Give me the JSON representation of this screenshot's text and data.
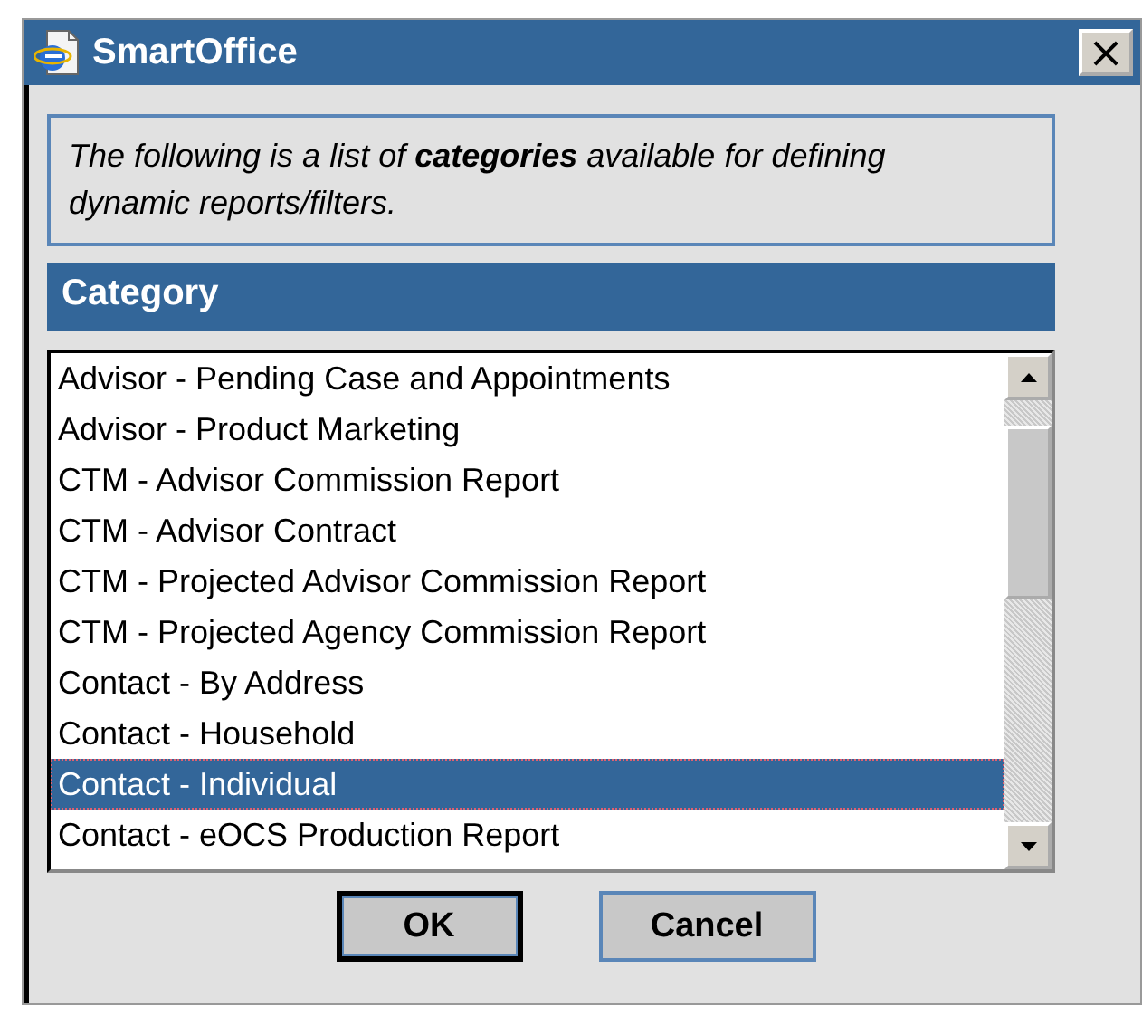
{
  "window": {
    "title": "SmartOffice",
    "close": "×"
  },
  "intro": "The following is a list of **categories** available for defining dynamic reports/filters.",
  "list_header": "Category",
  "categories": [
    {
      "label": "Advisor - Pending Case and Appointments",
      "selected": false
    },
    {
      "label": "Advisor - Product Marketing",
      "selected": false
    },
    {
      "label": "CTM - Advisor Commission Report",
      "selected": false
    },
    {
      "label": "CTM - Advisor Contract",
      "selected": false
    },
    {
      "label": "CTM - Projected Advisor Commission Report",
      "selected": false
    },
    {
      "label": "CTM - Projected Agency Commission Report",
      "selected": false
    },
    {
      "label": "Contact - By Address",
      "selected": false
    },
    {
      "label": "Contact - Household",
      "selected": false
    },
    {
      "label": "Contact - Individual",
      "selected": true
    },
    {
      "label": "Contact - eOCS Production Report",
      "selected": false
    }
  ],
  "buttons": [
    {
      "label": "OK",
      "default": true
    },
    {
      "label": "Cancel",
      "default": false
    }
  ]
}
